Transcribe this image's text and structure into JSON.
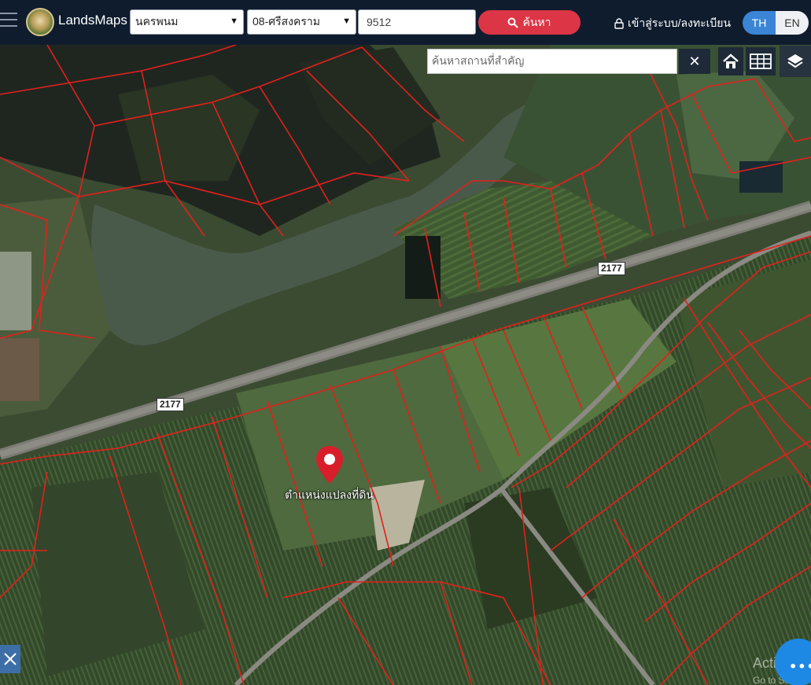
{
  "header": {
    "logo_text": "LandsMaps",
    "province_select": {
      "value": "นครพนม"
    },
    "district_select": {
      "value": "08-ศรีสงคราม"
    },
    "parcel_input": {
      "value": "9512"
    },
    "search_button_label": "ค้นหา",
    "login_label": "เข้าสู่ระบบ/ลงทะเบียน",
    "lang_th": "TH",
    "lang_en": "EN"
  },
  "map": {
    "place_search_placeholder": "ค้นหาสถานที่สำคัญ",
    "clear_symbol": "✕",
    "road_labels": [
      "2177",
      "2177"
    ],
    "pin_label": "ตำแหน่งแปลงที่ดิน",
    "watermark_title": "Activate",
    "watermark_sub": "Go to Setti",
    "chat_dots": "•••"
  },
  "colors": {
    "topbar": "#0f1c2e",
    "search_button": "#dc3545",
    "lang_active": "#3a85d6",
    "parcel_lines": "#e3201c",
    "pin": "#d81e2a"
  }
}
